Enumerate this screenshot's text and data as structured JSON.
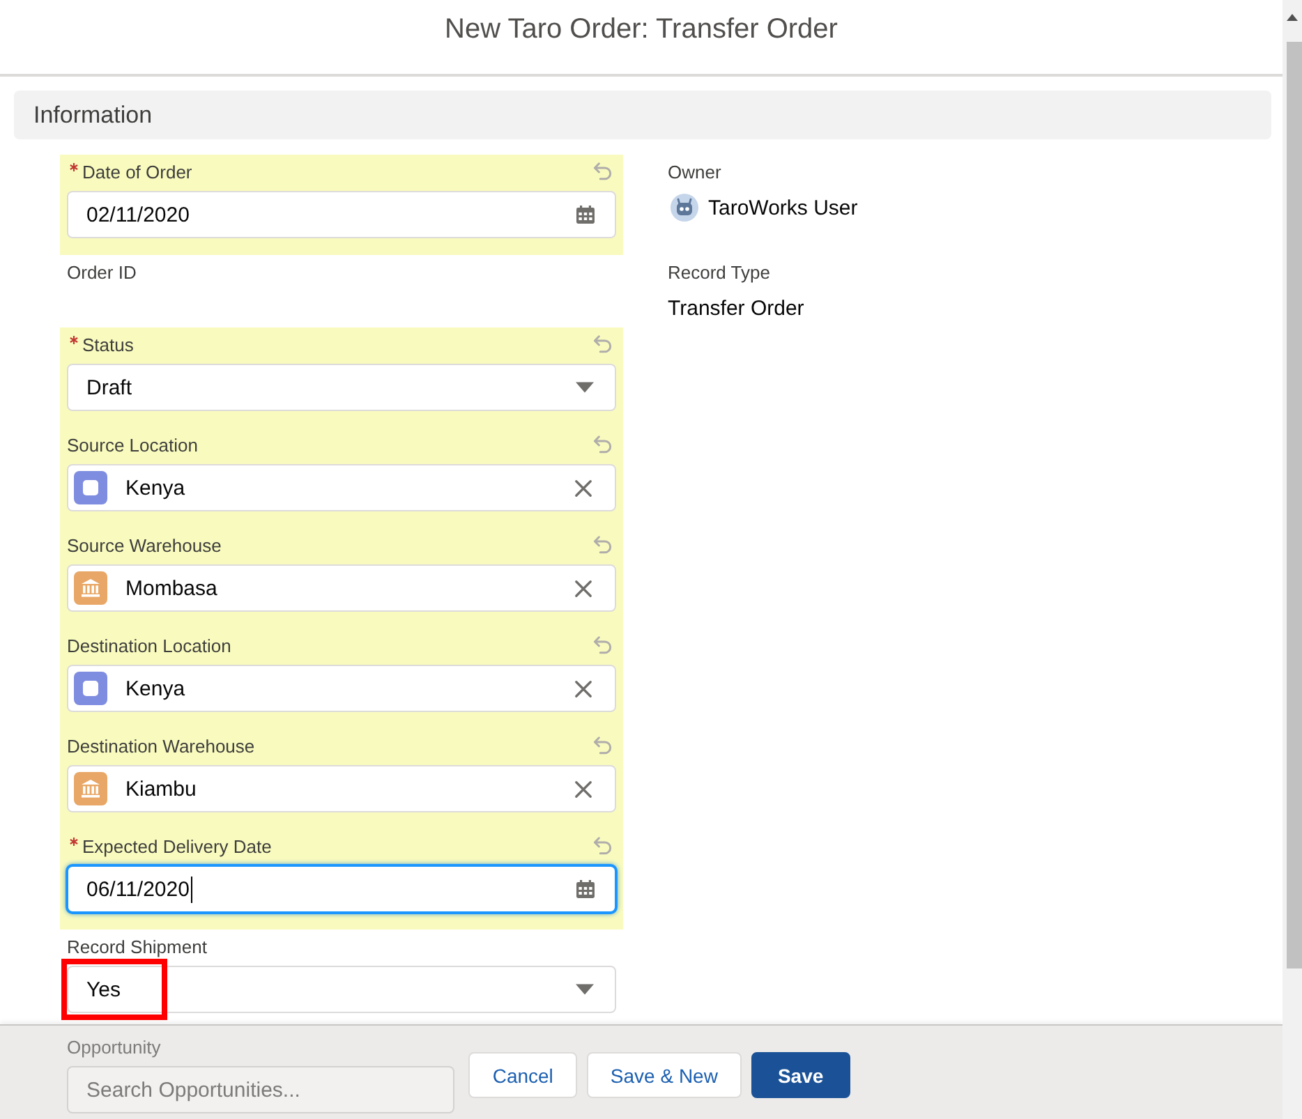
{
  "modal": {
    "title": "New Taro Order: Transfer Order"
  },
  "section": {
    "title": "Information"
  },
  "left_fields": [
    {
      "kind": "date",
      "label": "Date of Order",
      "required": true,
      "changed": true,
      "focused": false,
      "highlighted": false,
      "value": "02/11/2020"
    },
    {
      "kind": "readonly",
      "label": "Order ID",
      "required": false,
      "changed": false,
      "focused": false,
      "highlighted": false
    },
    {
      "kind": "picklist",
      "label": "Status",
      "required": true,
      "changed": true,
      "focused": false,
      "highlighted": false,
      "value": "Draft"
    },
    {
      "kind": "location_lookup",
      "label": "Source Location",
      "required": false,
      "changed": true,
      "focused": false,
      "highlighted": false,
      "value": "Kenya"
    },
    {
      "kind": "warehouse_lookup",
      "label": "Source Warehouse",
      "required": false,
      "changed": true,
      "focused": false,
      "highlighted": false,
      "value": "Mombasa"
    },
    {
      "kind": "location_lookup",
      "label": "Destination Location",
      "required": false,
      "changed": true,
      "focused": false,
      "highlighted": false,
      "value": "Kenya"
    },
    {
      "kind": "warehouse_lookup",
      "label": "Destination Warehouse",
      "required": false,
      "changed": true,
      "focused": false,
      "highlighted": false,
      "value": "Kiambu"
    },
    {
      "kind": "date",
      "label": "Expected Delivery Date",
      "required": true,
      "changed": true,
      "focused": true,
      "highlighted": false,
      "value": "06/11/2020"
    },
    {
      "kind": "picklist",
      "label": "Record Shipment",
      "required": false,
      "changed": false,
      "focused": false,
      "highlighted": true,
      "value": "Yes"
    },
    {
      "kind": "search",
      "label": "Opportunity",
      "required": false,
      "changed": false,
      "focused": false,
      "highlighted": false,
      "placeholder": "Search Opportunities..."
    }
  ],
  "right_fields": [
    {
      "kind": "user",
      "label": "Owner",
      "value": "TaroWorks User"
    },
    {
      "kind": "text",
      "label": "Record Type",
      "value": "Transfer Order"
    }
  ],
  "buttons": [
    {
      "kind": "neutral",
      "label": "Cancel"
    },
    {
      "kind": "neutral",
      "label": "Save & New"
    },
    {
      "kind": "brand",
      "label": "Save"
    }
  ]
}
